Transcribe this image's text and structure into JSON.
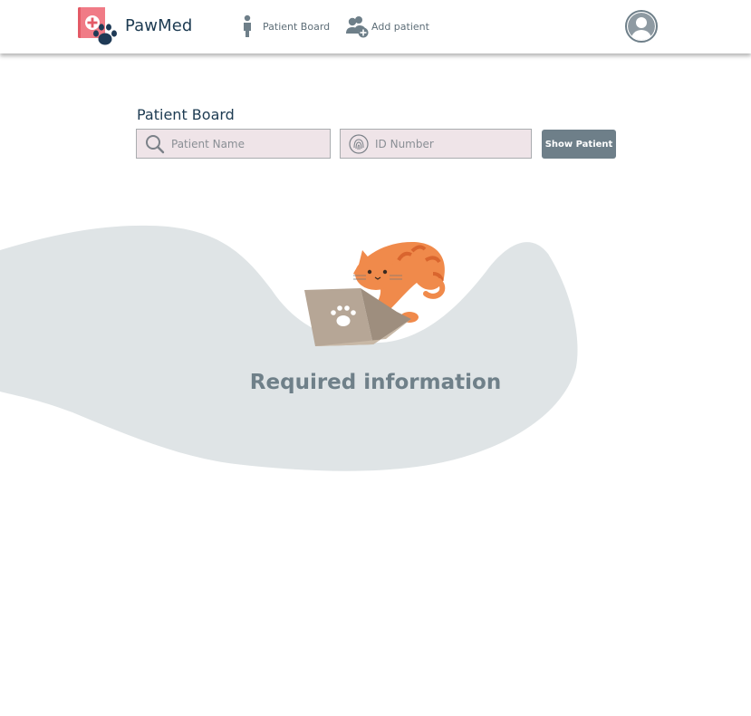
{
  "header": {
    "brand": "PawMed",
    "nav": [
      {
        "label": "Patient Board",
        "icon": "person-icon"
      },
      {
        "label": "Add patient",
        "icon": "add-user-icon"
      }
    ],
    "avatar_icon": "user-avatar-icon"
  },
  "main": {
    "title": "Patient Board",
    "search": {
      "name_placeholder": "Patient Name",
      "name_value": "",
      "id_placeholder": "ID Number",
      "id_value": "",
      "button_label": "Show Patient"
    },
    "empty_state": {
      "illustration": "cat-laptop-illustration",
      "message": "Required information"
    }
  },
  "colors": {
    "brand_text": "#1d3b52",
    "input_bg": "#efe4e8",
    "button_bg": "#6e7f89",
    "blob_bg": "#dfe4e6",
    "message_text": "#6f8089",
    "logo_red": "#e45a66",
    "paw_dark": "#1f3a56",
    "cat_orange": "#f08a4b"
  }
}
